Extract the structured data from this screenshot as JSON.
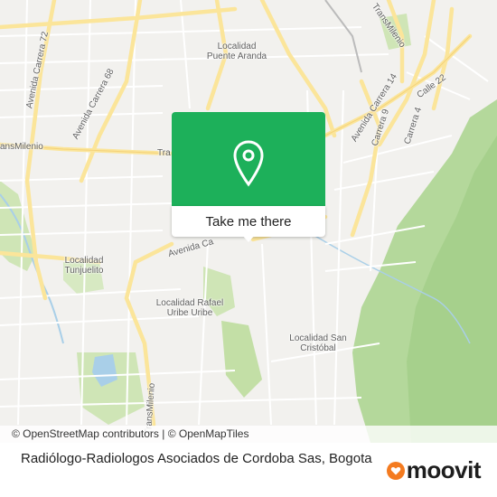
{
  "map": {
    "labels": {
      "avenida_carrera_72": "Avenida Carrera 72",
      "avenida_carrera_68": "Avenida Carrera 68",
      "localidad_puente_aranda": "Localidad\nPuente Aranda",
      "transmilenio_top": "TransMilenio",
      "transmilenio_left": "ansMilenio",
      "transmilenio_mid": "Tra",
      "avenida_carrera_14": "Avenida Carrera 14",
      "carrera_9": "Carrera 9",
      "carrera_4": "Carrera 4",
      "calle_22": "Calle 22",
      "avenida_calle": "Avenida Ca",
      "localidad_tunjuelito": "Localidad\nTunjuelito",
      "localidad_rafael_uribe": "Localidad Rafael\nUribe Uribe",
      "localidad_san_cristobal": "Localidad San\nCristóbal",
      "transmilenio_bottom": "TransMilenio"
    },
    "colors": {
      "background": "#f2f1ee",
      "major_road": "#fbe59a",
      "minor_road": "#ffffff",
      "park": "#cfe5b6",
      "forest": "#b4d89b",
      "water": "#a9cfe8"
    }
  },
  "popup": {
    "button_label": "Take me there",
    "pin_icon": "map-marker-icon",
    "color": "#1db05a"
  },
  "attribution": {
    "text": "© OpenStreetMap contributors | © OpenMapTiles"
  },
  "place": {
    "name": "Radiólogo-Radiologos Asociados de Cordoba Sas, Bogota"
  },
  "brand": {
    "name": "moovit",
    "accent": "#f47b20"
  }
}
